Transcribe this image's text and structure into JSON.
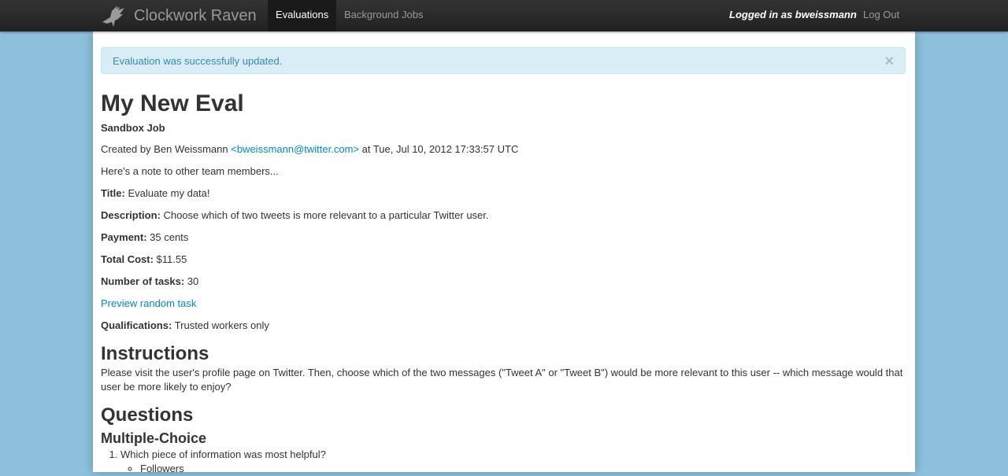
{
  "nav": {
    "brand": "Clockwork Raven",
    "tabs": [
      "Evaluations",
      "Background Jobs"
    ],
    "logged_in": "Logged in as bweissmann",
    "logout": "Log Out"
  },
  "alert": {
    "message": "Evaluation was successfully updated.",
    "close": "×"
  },
  "eval": {
    "title": "My New Eval",
    "subtitle": "Sandbox Job",
    "created_prefix": "Created by Ben Weissmann ",
    "created_email": "<bweissmann@twitter.com>",
    "created_suffix": " at Tue, Jul 10, 2012 17:33:57 UTC",
    "note": "Here's a note to other team members...",
    "title_label": "Title:",
    "title_value": " Evaluate my data!",
    "description_label": "Description:",
    "description_value": " Choose which of two tweets is more relevant to a particular Twitter user.",
    "payment_label": "Payment:",
    "payment_value": " 35 cents",
    "total_cost_label": "Total Cost:",
    "total_cost_value": " $11.55",
    "tasks_label": "Number of tasks:",
    "tasks_value": " 30",
    "preview_link": "Preview random task",
    "qualifications_label": "Qualifications:",
    "qualifications_value": " Trusted workers only"
  },
  "instructions": {
    "heading": "Instructions",
    "text": "Please visit the user's profile page on Twitter. Then, choose which of the two messages (\"Tweet A\" or \"Tweet B\") would be more relevant to this user -- which message would that user be more likely to enjoy?"
  },
  "questions": {
    "heading": "Questions",
    "mc_heading": "Multiple-Choice",
    "items": [
      {
        "text": "Which piece of information was most helpful?",
        "options": [
          "Followers"
        ]
      }
    ]
  }
}
